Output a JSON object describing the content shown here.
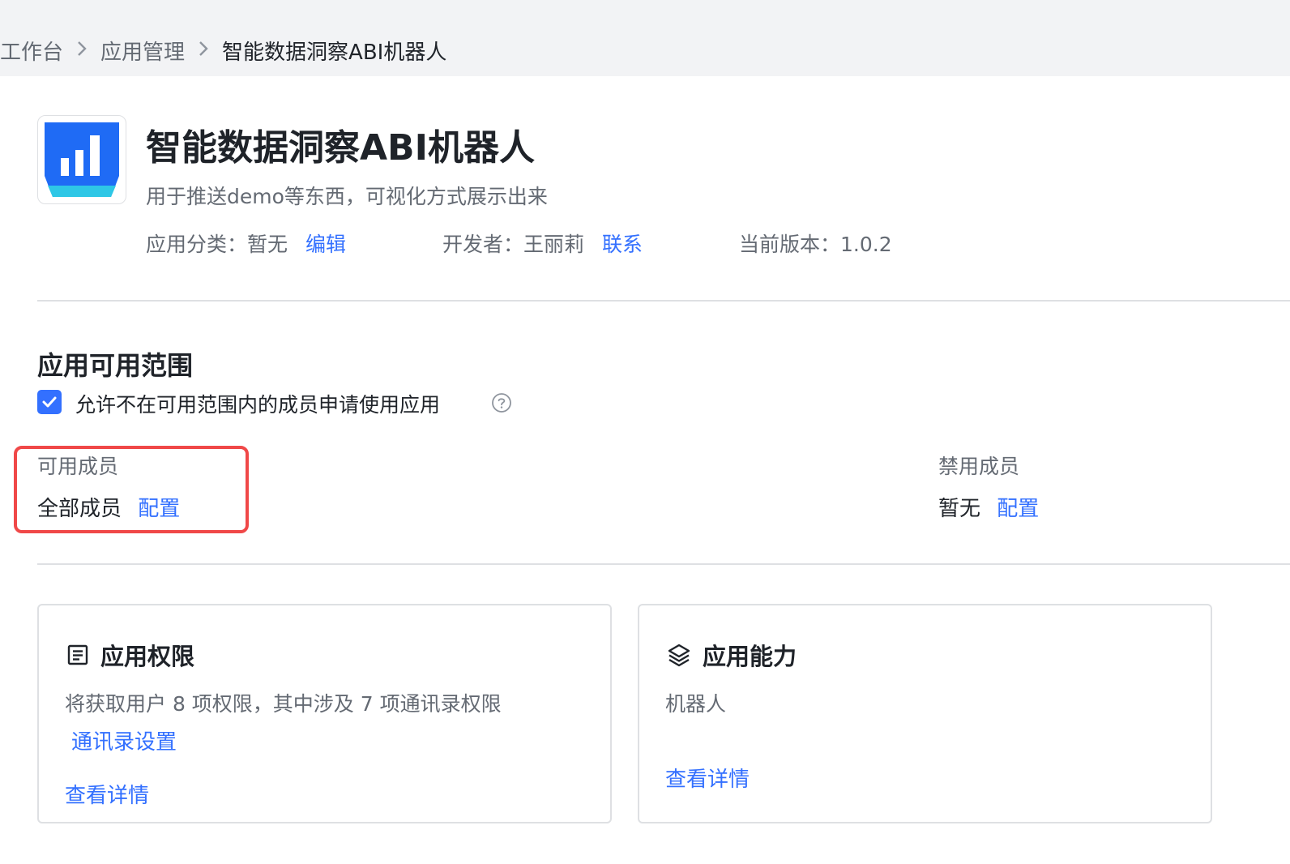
{
  "breadcrumb": {
    "items": [
      "工作台",
      "应用管理",
      "智能数据洞察ABI机器人"
    ]
  },
  "app": {
    "name": "智能数据洞察ABI机器人",
    "description": "用于推送demo等东西，可视化方式展示出来",
    "category_label": "应用分类：",
    "category_value": "暂无",
    "category_edit": "编辑",
    "developer_label": "开发者：",
    "developer_value": "王丽莉",
    "developer_contact": "联系",
    "version_label": "当前版本：",
    "version_value": "1.0.2"
  },
  "availability": {
    "title": "应用可用范围",
    "allow_request_label": "允许不在可用范围内的成员申请使用应用",
    "allow_request_checked": true,
    "available_members": {
      "label": "可用成员",
      "value": "全部成员",
      "action": "配置"
    },
    "blocked_members": {
      "label": "禁用成员",
      "value": "暂无",
      "action": "配置"
    }
  },
  "cards": {
    "permissions": {
      "title": "应用权限",
      "text": "将获取用户 8 项权限，其中涉及 7 项通讯录权限",
      "settings_link": "通讯录设置",
      "details_link": "查看详情"
    },
    "capabilities": {
      "title": "应用能力",
      "text": "机器人",
      "details_link": "查看详情"
    }
  },
  "colors": {
    "accent": "#3370ff",
    "highlight_border": "#f04848",
    "topbar_bg": "#f2f3f5"
  }
}
